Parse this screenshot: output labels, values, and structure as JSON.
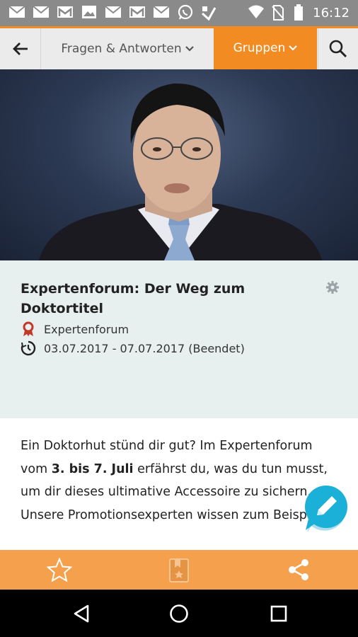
{
  "status_bar": {
    "time": "16:12",
    "icons": [
      "mail-icon",
      "mail-icon",
      "gmail-icon",
      "image-icon",
      "mail-icon",
      "gmail-icon",
      "mail-icon",
      "whatsapp-icon",
      "app-icon",
      "wifi-icon",
      "no-sim-icon",
      "battery-icon"
    ]
  },
  "app_bar": {
    "back_icon": "arrow-left-icon",
    "tab_qa_label": "Fragen & Antworten",
    "tab_groups_label": "Gruppen",
    "search_icon": "search-icon",
    "accent_color": "#f28b22"
  },
  "forum": {
    "title": "Expertenforum: Der Weg zum Doktortitel",
    "category": "Expertenforum",
    "dates": "03.07.2017 - 07.07.2017 (Beendet)"
  },
  "body": {
    "p1": "Ein Doktorhut stünd dir gut? Im Expertenforum vom ",
    "bold1": "3. bis 7. Juli",
    "p2": " erfährst du, was du tun musst, um dir dieses ultimative Accessoire zu sichern. Unsere Promotionsexperten wissen zum Beispiel,"
  },
  "bottom_bar": {
    "icons": [
      "star-icon",
      "bookmark-icon",
      "share-icon"
    ],
    "color": "#f5a04c"
  },
  "nav_bar": {
    "icons": [
      "back-triangle-icon",
      "home-circle-icon",
      "recents-square-icon"
    ]
  }
}
